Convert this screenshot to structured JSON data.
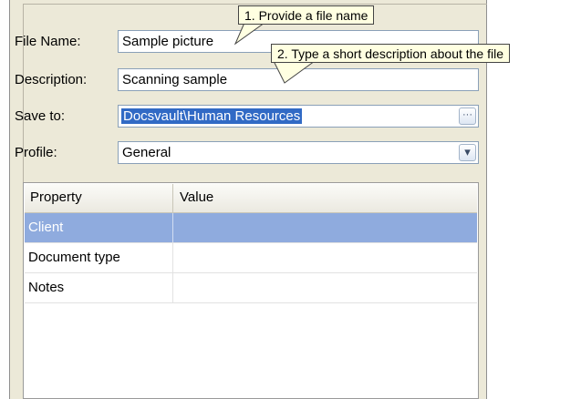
{
  "form": {
    "file_name_label": "File Name:",
    "file_name_value": "Sample picture",
    "description_label": "Description:",
    "description_value": "Scanning sample",
    "save_to_label": "Save to:",
    "save_to_value": "Docsvault\\Human Resources",
    "browse_label": "···",
    "profile_label": "Profile:",
    "profile_value": "General",
    "dropdown_glyph": "▾"
  },
  "grid": {
    "headers": [
      "Property",
      "Value"
    ],
    "rows": [
      {
        "property": "Client",
        "value": "",
        "selected": true
      },
      {
        "property": "Document type",
        "value": "",
        "selected": false
      },
      {
        "property": "Notes",
        "value": "",
        "selected": false
      }
    ]
  },
  "callouts": {
    "first": "1. Provide a file name",
    "second": "2. Type a short description about the file"
  },
  "colors": {
    "panel_bg": "#ece9d8",
    "selection": "#316ac5",
    "row_selected": "#8fabde",
    "callout_bg": "#ffffe1"
  }
}
